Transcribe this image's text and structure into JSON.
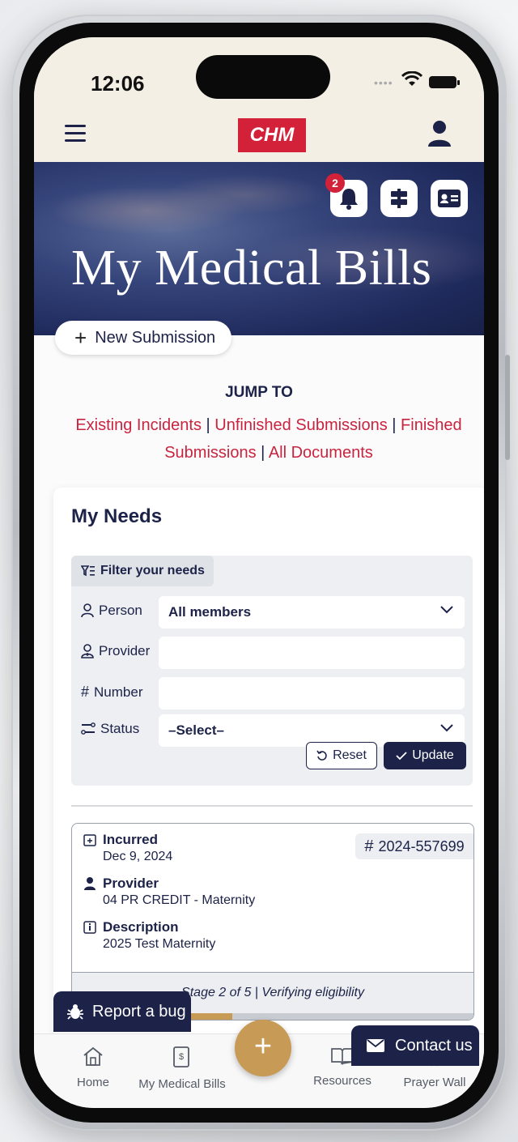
{
  "status_bar": {
    "time": "12:06"
  },
  "header": {
    "logo": "CHM"
  },
  "hero": {
    "title": "My Medical Bills",
    "notification_count": "2"
  },
  "new_submission": {
    "label": "New Submission"
  },
  "jump_to": {
    "heading": "JUMP TO",
    "links": [
      "Existing Incidents",
      "Unfinished Submissions",
      "Finished Submissions",
      "All Documents"
    ],
    "separator": " | "
  },
  "needs": {
    "title": "My Needs",
    "filter": {
      "tab_label": "Filter your needs",
      "person_label": "Person",
      "person_value": "All members",
      "provider_label": "Provider",
      "provider_value": "",
      "number_label": "Number",
      "number_value": "",
      "status_label": "Status",
      "status_value": "–Select–",
      "reset_label": "Reset",
      "update_label": "Update"
    },
    "item": {
      "number": "2024-557699",
      "incurred_label": "Incurred",
      "incurred_value": "Dec 9, 2024",
      "provider_label": "Provider",
      "provider_value": "04 PR CREDIT - Maternity",
      "description_label": "Description",
      "description_value": "2025 Test Maternity",
      "stage_text": "Stage 2 of 5 | Verifying eligibility",
      "progress": 0.4
    }
  },
  "floating": {
    "report_bug": "Report a bug",
    "contact_us": "Contact us"
  },
  "bottom_nav": {
    "home": "Home",
    "medical_bills": "My Medical Bills",
    "resources": "Resources",
    "prayer_wall": "Prayer Wall"
  },
  "colors": {
    "navy": "#1c2248",
    "red": "#d3213a",
    "gold": "#c79a55",
    "link_red": "#c9243f"
  }
}
